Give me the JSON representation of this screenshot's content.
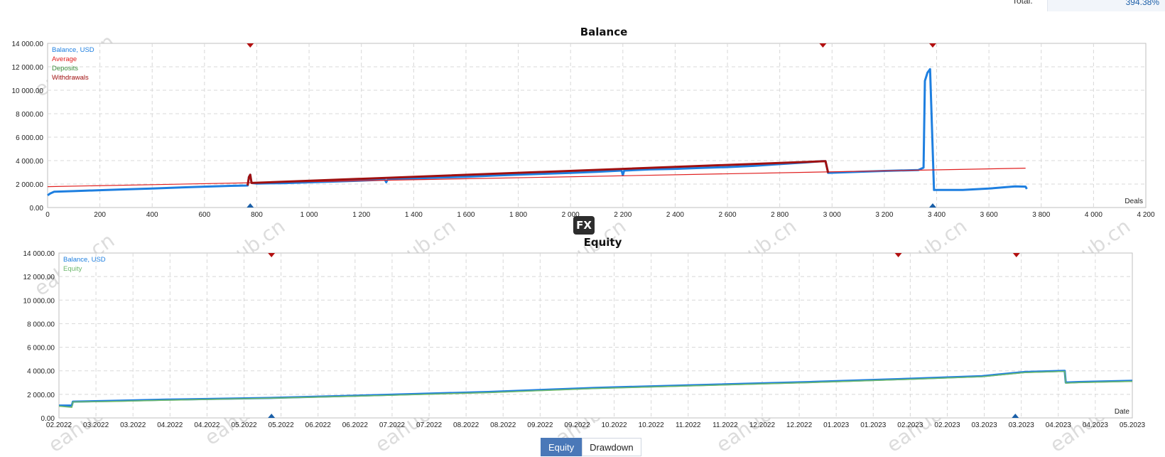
{
  "header": {
    "total_label": "Total:",
    "total_value": "394.38%"
  },
  "watermark": "eahub.cn",
  "logo": "FX",
  "tabs": [
    {
      "label": "Equity",
      "active": true
    },
    {
      "label": "Drawdown",
      "active": false
    }
  ],
  "colors": {
    "balance": "#1e7fe0",
    "average": "#e02020",
    "deposits": "#3a8a3a",
    "withdrawals": "#a01010",
    "equity": "#6cb86c",
    "grid": "#d8d8d8"
  },
  "chart_data": [
    {
      "type": "line",
      "title": "Balance",
      "xlabel": "Deals",
      "ylabel": "",
      "xlim": [
        0,
        4200
      ],
      "ylim": [
        0,
        14000
      ],
      "x_ticks": [
        0,
        200,
        400,
        600,
        800,
        1000,
        1200,
        1400,
        1600,
        1800,
        2000,
        2200,
        2400,
        2600,
        2800,
        3000,
        3200,
        3400,
        3600,
        3800,
        4000,
        4200
      ],
      "x_tick_labels": [
        "0",
        "200",
        "400",
        "600",
        "800",
        "1 000",
        "1 200",
        "1 400",
        "1 600",
        "1 800",
        "2 000",
        "2 200",
        "2 400",
        "2 600",
        "2 800",
        "3 000",
        "3 200",
        "3 400",
        "3 600",
        "3 800",
        "4 000",
        "4 200"
      ],
      "y_ticks": [
        0,
        2000,
        4000,
        6000,
        8000,
        10000,
        12000,
        14000
      ],
      "y_tick_labels": [
        "0.00",
        "2 000.00",
        "4 000.00",
        "6 000.00",
        "8 000.00",
        "10 000.00",
        "12 000.00",
        "14 000.00"
      ],
      "legend": [
        "Balance, USD",
        "Average",
        "Deposits",
        "Withdrawals"
      ],
      "legend_placement": "top-left",
      "grid": true,
      "series": [
        {
          "name": "Balance, USD",
          "points": [
            [
              0,
              1050
            ],
            [
              10,
              1200
            ],
            [
              25,
              1350
            ],
            [
              100,
              1400
            ],
            [
              200,
              1480
            ],
            [
              300,
              1550
            ],
            [
              400,
              1620
            ],
            [
              500,
              1700
            ],
            [
              600,
              1780
            ],
            [
              700,
              1850
            ],
            [
              765,
              1880
            ],
            [
              770,
              2600
            ],
            [
              775,
              2800
            ],
            [
              780,
              2100
            ],
            [
              800,
              2050
            ],
            [
              900,
              2080
            ],
            [
              1000,
              2150
            ],
            [
              1100,
              2220
            ],
            [
              1200,
              2300
            ],
            [
              1290,
              2380
            ],
            [
              1295,
              2150
            ],
            [
              1300,
              2380
            ],
            [
              1400,
              2480
            ],
            [
              1500,
              2560
            ],
            [
              1600,
              2620
            ],
            [
              1700,
              2720
            ],
            [
              1800,
              2800
            ],
            [
              1900,
              2880
            ],
            [
              2000,
              2950
            ],
            [
              2100,
              3050
            ],
            [
              2195,
              3150
            ],
            [
              2200,
              2750
            ],
            [
              2205,
              3150
            ],
            [
              2300,
              3250
            ],
            [
              2400,
              3300
            ],
            [
              2500,
              3380
            ],
            [
              2600,
              3450
            ],
            [
              2700,
              3550
            ],
            [
              2800,
              3700
            ],
            [
              2900,
              3850
            ],
            [
              2960,
              3950
            ],
            [
              2975,
              3950
            ],
            [
              2985,
              2950
            ],
            [
              3100,
              3050
            ],
            [
              3200,
              3120
            ],
            [
              3330,
              3200
            ],
            [
              3350,
              3400
            ],
            [
              3355,
              10800
            ],
            [
              3365,
              11500
            ],
            [
              3375,
              11800
            ],
            [
              3390,
              1500
            ],
            [
              3500,
              1500
            ],
            [
              3600,
              1620
            ],
            [
              3700,
              1800
            ],
            [
              3740,
              1780
            ],
            [
              3745,
              1580
            ]
          ]
        },
        {
          "name": "Average",
          "points": [
            [
              0,
              1780
            ],
            [
              3740,
              3360
            ]
          ]
        },
        {
          "name": "Withdrawals",
          "points": [
            [
              765,
              1880
            ],
            [
              770,
              2600
            ],
            [
              775,
              2800
            ],
            [
              780,
              2100
            ],
            [
              2975,
              3950
            ],
            [
              2985,
              2950
            ]
          ]
        }
      ],
      "markers_top": [
        775,
        2965,
        3385
      ],
      "markers_bottom": [
        775,
        3385
      ]
    },
    {
      "type": "line",
      "title": "Equity",
      "xlabel": "Date",
      "ylabel": "",
      "xlim": [
        0,
        1
      ],
      "ylim": [
        0,
        14000
      ],
      "x_tick_labels": [
        "02.2022",
        "03.2022",
        "03.2022",
        "04.2022",
        "04.2022",
        "05.2022",
        "05.2022",
        "06.2022",
        "06.2022",
        "07.2022",
        "07.2022",
        "08.2022",
        "08.2022",
        "09.2022",
        "09.2022",
        "10.2022",
        "10.2022",
        "11.2022",
        "11.2022",
        "12.2022",
        "12.2022",
        "01.2023",
        "01.2023",
        "02.2023",
        "02.2023",
        "03.2023",
        "03.2023",
        "04.2023",
        "04.2023",
        "05.2023"
      ],
      "y_ticks": [
        0,
        2000,
        4000,
        6000,
        8000,
        10000,
        12000,
        14000
      ],
      "y_tick_labels": [
        "0.00",
        "2 000.00",
        "4 000.00",
        "6 000.00",
        "8 000.00",
        "10 000.00",
        "12 000.00",
        "14 000.00"
      ],
      "legend": [
        "Balance, USD",
        "Equity"
      ],
      "legend_placement": "top-left",
      "grid": true,
      "series": [
        {
          "name": "Balance, USD",
          "points": [
            [
              0,
              1050
            ],
            [
              0.012,
              1050
            ],
            [
              0.013,
              1380
            ],
            [
              0.05,
              1450
            ],
            [
              0.1,
              1550
            ],
            [
              0.2,
              1700
            ],
            [
              0.3,
              1950
            ],
            [
              0.4,
              2200
            ],
            [
              0.5,
              2550
            ],
            [
              0.6,
              2800
            ],
            [
              0.7,
              3050
            ],
            [
              0.75,
              3200
            ],
            [
              0.8,
              3350
            ],
            [
              0.86,
              3550
            ],
            [
              0.9,
              3900
            ],
            [
              0.937,
              4000
            ],
            [
              0.938,
              3000
            ],
            [
              0.95,
              3050
            ],
            [
              1.0,
              3150
            ],
            [
              1.0,
              3150
            ]
          ]
        },
        {
          "name": "Equity",
          "points": [
            [
              0,
              1000
            ],
            [
              0.012,
              900
            ],
            [
              0.013,
              1350
            ],
            [
              0.05,
              1400
            ],
            [
              0.1,
              1500
            ],
            [
              0.2,
              1680
            ],
            [
              0.3,
              1900
            ],
            [
              0.4,
              2150
            ],
            [
              0.5,
              2500
            ],
            [
              0.6,
              2750
            ],
            [
              0.7,
              3000
            ],
            [
              0.75,
              3150
            ],
            [
              0.8,
              3300
            ],
            [
              0.86,
              3500
            ],
            [
              0.9,
              3850
            ],
            [
              0.937,
              3950
            ],
            [
              0.938,
              2950
            ],
            [
              0.95,
              3000
            ],
            [
              1.0,
              3100
            ]
          ]
        }
      ],
      "markers_top": [
        0.198,
        0.782,
        0.892
      ],
      "markers_bottom": [
        0.198,
        0.891
      ]
    }
  ]
}
